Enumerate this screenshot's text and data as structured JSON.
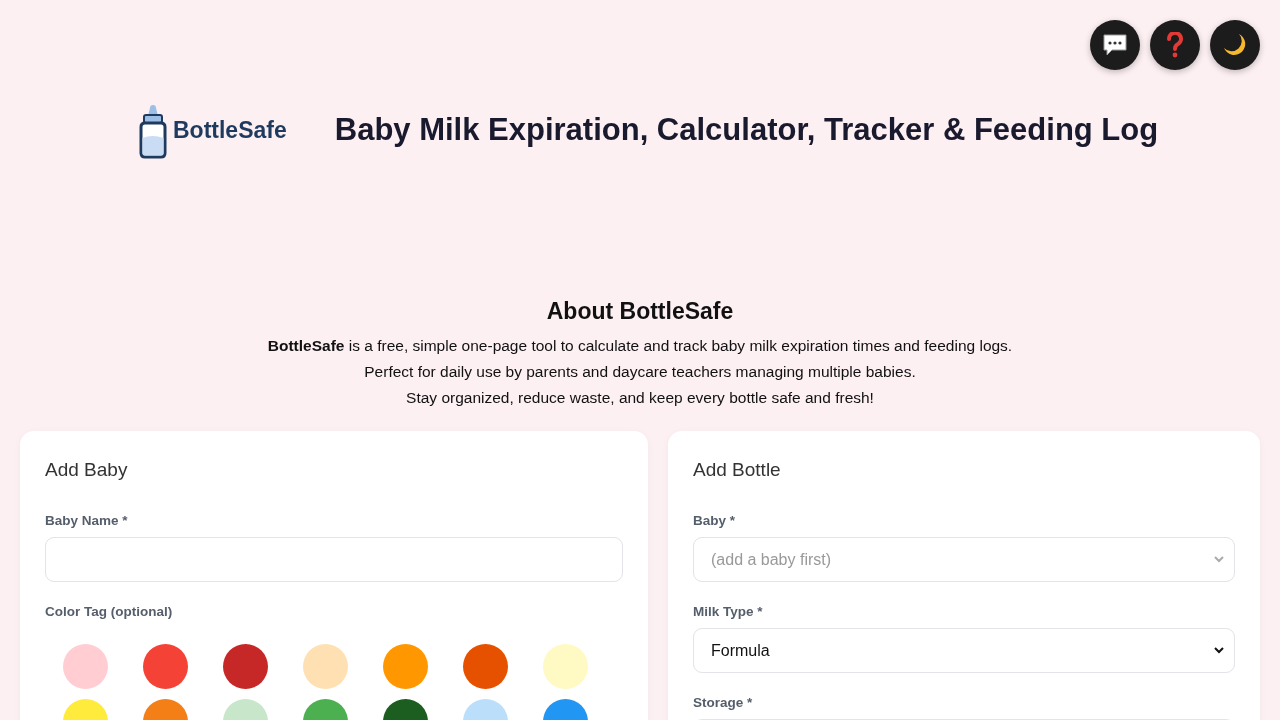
{
  "top_actions": [
    {
      "kind": "chat"
    },
    {
      "kind": "help"
    },
    {
      "kind": "theme"
    }
  ],
  "header": {
    "logo_text": "BottleSafe",
    "title": "Baby Milk Expiration, Calculator, Tracker & Feeding Log"
  },
  "about": {
    "heading": "About BottleSafe",
    "lines": [
      "**BottleSafe** is a free, simple one-page tool to calculate and track baby milk expiration times and feeding logs.",
      "Perfect for daily use by parents and daycare teachers managing multiple babies.",
      "Stay organized, reduce waste, and keep every bottle safe and fresh!"
    ]
  },
  "add_baby": {
    "title": "Add Baby",
    "name_label": "Baby Name *",
    "color_label": "Color Tag (optional)",
    "colors": [
      {
        "color": "#ffcdd2"
      },
      {
        "color": "#f44336"
      },
      {
        "color": "#c62828"
      },
      {
        "color": "#ffe0b2"
      },
      {
        "color": "#ff9800"
      },
      {
        "color": "#e65100"
      },
      {
        "color": "#fff9c4"
      },
      {
        "color": "#ffeb3b"
      },
      {
        "color": "#f57f17"
      },
      {
        "color": "#c8e6c9"
      },
      {
        "color": "#4caf50"
      },
      {
        "color": "#1b5e20"
      },
      {
        "color": "#bbdefb"
      },
      {
        "color": "#2196f3"
      }
    ]
  },
  "add_bottle": {
    "title": "Add Bottle",
    "fields": [
      {
        "label": "Baby *",
        "value": "(add a baby first)",
        "disabled": true
      },
      {
        "label": "Milk Type *",
        "value": "Formula",
        "disabled": false
      },
      {
        "label": "Storage *"
      }
    ]
  }
}
